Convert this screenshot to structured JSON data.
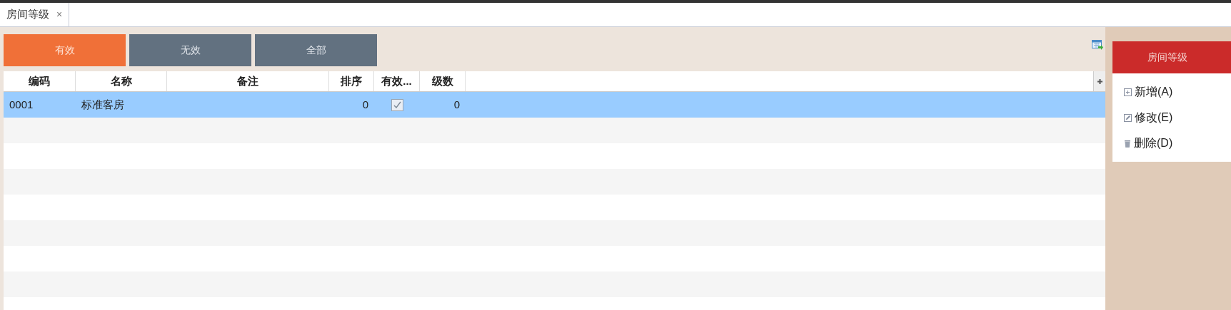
{
  "tabs": [
    {
      "label": "房间等级",
      "selected": true,
      "close": "×"
    }
  ],
  "filters": [
    {
      "label": "有效",
      "selected": true
    },
    {
      "label": "无效",
      "selected": false
    },
    {
      "label": "全部",
      "selected": false
    }
  ],
  "table": {
    "columns": [
      "编码",
      "名称",
      "备注",
      "排序",
      "有效...",
      "级数"
    ],
    "rows": [
      {
        "cells": [
          "0001",
          "标准客房",
          "",
          "0",
          "",
          "0"
        ],
        "valid": true,
        "selected": true
      }
    ]
  },
  "side_panel": {
    "title": "房间等级",
    "actions": [
      {
        "kind": "add",
        "label": "新增(A)"
      },
      {
        "kind": "edit",
        "label": "修改(E)"
      },
      {
        "kind": "delete",
        "label": "删除(D)"
      }
    ]
  }
}
